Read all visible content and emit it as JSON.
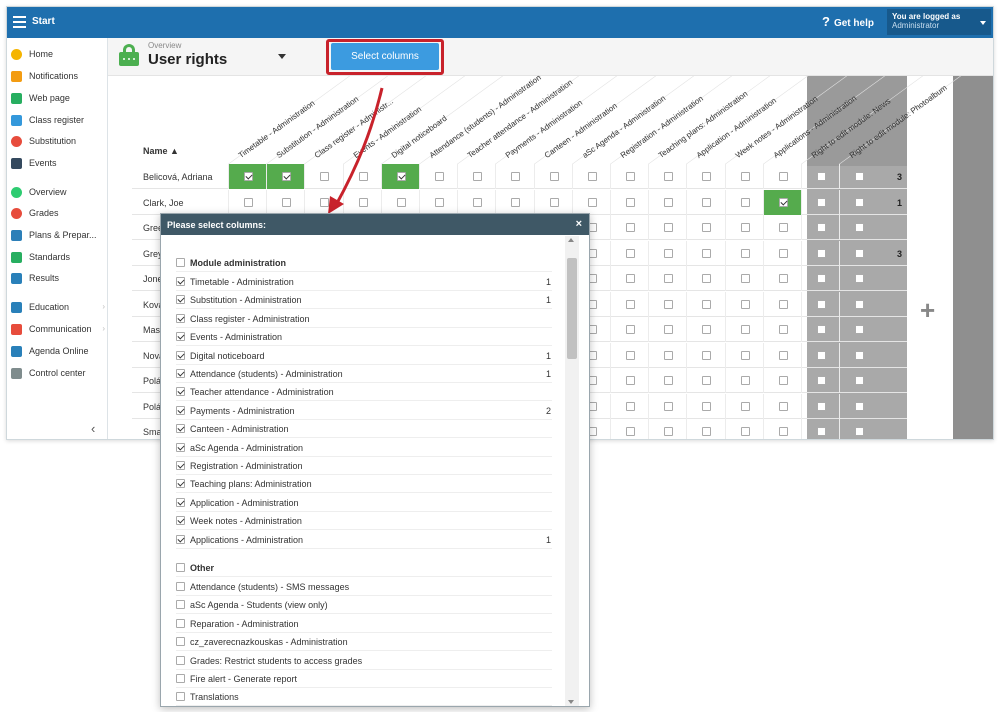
{
  "topbar": {
    "start": "Start",
    "help": "Get help",
    "logged_as": "You are logged as",
    "role": "Administrator"
  },
  "sidebar": {
    "items": [
      {
        "label": "Home",
        "icon": "star-icon",
        "color": "#f5b400"
      },
      {
        "label": "Notifications",
        "icon": "envelope-icon",
        "color": "#f39c12"
      },
      {
        "label": "Web page",
        "icon": "house-icon",
        "color": "#27ae60"
      },
      {
        "label": "Class register",
        "icon": "book-icon",
        "color": "#3498db"
      },
      {
        "label": "Substitution",
        "icon": "person-icon",
        "color": "#e74c3c"
      },
      {
        "label": "Events",
        "icon": "calendar-icon",
        "color": "#34495e"
      },
      {
        "label": "Overview",
        "icon": "check-circle-icon",
        "color": "#2ecc71"
      },
      {
        "label": "Grades",
        "icon": "grade-icon",
        "color": "#e74c3c"
      },
      {
        "label": "Plans & Prepar...",
        "icon": "briefcase-icon",
        "color": "#2c7fb8"
      },
      {
        "label": "Standards",
        "icon": "shield-icon",
        "color": "#27ae60"
      },
      {
        "label": "Results",
        "icon": "bar-chart-icon",
        "color": "#2980b9"
      },
      {
        "label": "Education",
        "icon": "education-icon",
        "color": "#2980b9"
      },
      {
        "label": "Communication",
        "icon": "chat-icon",
        "color": "#e74c3c"
      },
      {
        "label": "Agenda Online",
        "icon": "pen-icon",
        "color": "#2980b9"
      },
      {
        "label": "Control center",
        "icon": "gear-icon",
        "color": "#7f8c8d"
      }
    ]
  },
  "header": {
    "breadcrumb": "Overview",
    "title": "User rights",
    "select_button": "Select columns"
  },
  "grid": {
    "name_header": "Name ▲",
    "columns": [
      "Timetable - Administration",
      "Substitution - Administration",
      "Class register - Administr...",
      "Events - Administration",
      "Digital noticeboard",
      "Attendance (students) - Administration",
      "Teacher attendance - Administration",
      "Payments - Administration",
      "Canteen - Administration",
      "aSc Agenda - Administration",
      "Registration - Administration",
      "Teaching plans: Administration",
      "Application - Administration",
      "Week notes - Administration",
      "Applications - Administration",
      "Right to edit module: News",
      "Right to edit module: Photoalbum"
    ],
    "rows": [
      {
        "name": "Belicová, Adriana",
        "count": "3",
        "checked": [
          0,
          1,
          4
        ]
      },
      {
        "name": "Clark, Joe",
        "count": "1",
        "checked": [
          14
        ]
      },
      {
        "name": "Gree",
        "count": "",
        "checked": []
      },
      {
        "name": "Grey",
        "count": "3",
        "checked": []
      },
      {
        "name": "Jone",
        "count": "",
        "checked": []
      },
      {
        "name": "Ková",
        "count": "",
        "checked": []
      },
      {
        "name": "Masc",
        "count": "",
        "checked": []
      },
      {
        "name": "Nová",
        "count": "",
        "checked": []
      },
      {
        "name": "Polá",
        "count": "",
        "checked": []
      },
      {
        "name": "Polá",
        "count": "",
        "checked": []
      },
      {
        "name": "Sma",
        "count": "",
        "checked": []
      }
    ]
  },
  "modal": {
    "title": "Please select columns:",
    "close": "×",
    "sections": [
      {
        "title": "Module administration",
        "items": [
          {
            "label": "Timetable - Administration",
            "checked": true,
            "count": "1"
          },
          {
            "label": "Substitution - Administration",
            "checked": true,
            "count": "1"
          },
          {
            "label": "Class register - Administration",
            "checked": true,
            "count": ""
          },
          {
            "label": "Events - Administration",
            "checked": true,
            "count": ""
          },
          {
            "label": "Digital noticeboard",
            "checked": true,
            "count": "1"
          },
          {
            "label": "Attendance (students) - Administration",
            "checked": true,
            "count": "1"
          },
          {
            "label": "Teacher attendance - Administration",
            "checked": true,
            "count": ""
          },
          {
            "label": "Payments - Administration",
            "checked": true,
            "count": "2"
          },
          {
            "label": "Canteen - Administration",
            "checked": true,
            "count": ""
          },
          {
            "label": "aSc Agenda - Administration",
            "checked": true,
            "count": ""
          },
          {
            "label": "Registration - Administration",
            "checked": true,
            "count": ""
          },
          {
            "label": "Teaching plans: Administration",
            "checked": true,
            "count": ""
          },
          {
            "label": "Application - Administration",
            "checked": true,
            "count": ""
          },
          {
            "label": "Week notes - Administration",
            "checked": true,
            "count": ""
          },
          {
            "label": "Applications - Administration",
            "checked": true,
            "count": "1"
          }
        ]
      },
      {
        "title": "Other",
        "items": [
          {
            "label": "Attendance (students) - SMS messages",
            "checked": false,
            "count": ""
          },
          {
            "label": "aSc Agenda - Students (view only)",
            "checked": false,
            "count": ""
          },
          {
            "label": "Reparation - Administration",
            "checked": false,
            "count": ""
          },
          {
            "label": "cz_zaverecnazkouskas - Administration",
            "checked": false,
            "count": ""
          },
          {
            "label": "Grades: Restrict students to access grades",
            "checked": false,
            "count": ""
          },
          {
            "label": "Fire alert - Generate report",
            "checked": false,
            "count": ""
          },
          {
            "label": "Translations",
            "checked": false,
            "count": ""
          }
        ]
      }
    ]
  },
  "colors": {
    "topbar": "#1e6fae",
    "accent": "#3c9be0",
    "highlight": "#c8222b",
    "checked_cell": "#55ab4d",
    "modal_header": "#3f5866"
  }
}
